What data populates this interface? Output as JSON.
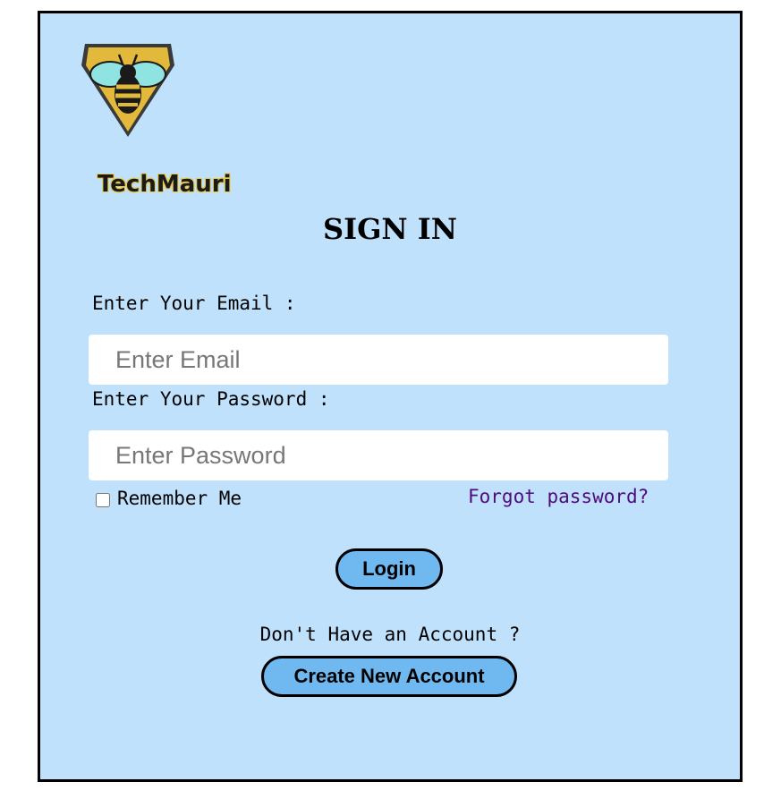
{
  "brand": {
    "name": "TechMauri"
  },
  "form": {
    "title": "SIGN IN",
    "email_label": "Enter Your Email :",
    "email_placeholder": "Enter Email",
    "email_value": "",
    "password_label": "Enter Your Password :",
    "password_placeholder": "Enter Password",
    "password_value": "",
    "remember_label": "Remember Me",
    "remember_checked": false,
    "forgot_link": "Forgot password?",
    "login_label": "Login",
    "no_account_text": "Don't Have an Account ?",
    "create_label": "Create New Account"
  },
  "colors": {
    "panel_bg": "#bfe1fb",
    "button_bg": "#6fb9f0",
    "link": "#4f0b7b",
    "logo_shield": "#e2b93b"
  },
  "icons": {
    "logo": "bee-shield-icon"
  }
}
